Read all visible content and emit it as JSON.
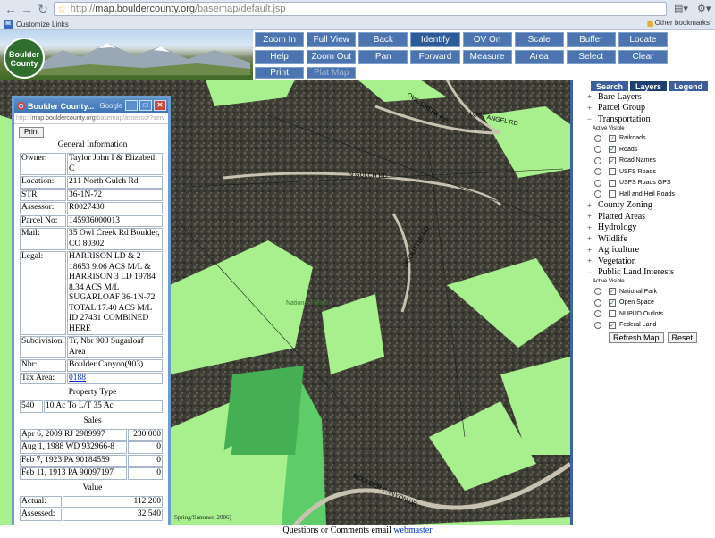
{
  "browser": {
    "url_host": "map.bouldercounty.org",
    "url_path": "/basemap/default.jsp",
    "bookmark_customize": "Customize Links",
    "other_bookmarks": "Other bookmarks"
  },
  "logo": {
    "line1": "Boulder",
    "line2": "County"
  },
  "toolbar": {
    "row1": [
      "Zoom In",
      "Full View",
      "Back",
      "Identify",
      "OV On",
      "Scale",
      "Buffer",
      "Locate",
      "Help"
    ],
    "row2": [
      "Zoom Out",
      "Pan",
      "Forward",
      "Measure",
      "Area",
      "Select",
      "Clear",
      "Print",
      "Plat Map"
    ]
  },
  "map": {
    "road_labels": [
      "OWL CREEK RD",
      "LOST ANGEL RD",
      "N GULCH RD",
      "DOOLITTLE RD",
      "BOULDER CANYON DR"
    ],
    "area_label": "National Forest",
    "imagery_label": "Spring/Summer, 2006)"
  },
  "sidebar": {
    "tabs": [
      "Search",
      "Layers",
      "Legend"
    ],
    "layers_top": [
      "Bare Layers",
      "Parcel Group",
      "Transportation"
    ],
    "active_visible": "Active Visible",
    "transportation_items": [
      {
        "label": "Railroads",
        "checked": true
      },
      {
        "label": "Roads",
        "checked": true
      },
      {
        "label": "Road Names",
        "checked": true
      },
      {
        "label": "USFS Roads",
        "checked": false
      },
      {
        "label": "USFS Roads GPS",
        "checked": false
      },
      {
        "label": "Hall and Heil Roads",
        "checked": false
      }
    ],
    "layers_mid": [
      "County Zoning",
      "Platted Areas",
      "Hydrology",
      "Wildlife",
      "Agriculture",
      "Vegetation",
      "Public Land Interests"
    ],
    "public_land_items": [
      {
        "label": "National Park",
        "checked": true
      },
      {
        "label": "Open Space",
        "checked": true
      },
      {
        "label": "NUPUD Outlots",
        "checked": false
      },
      {
        "label": "Federal Land",
        "checked": true
      }
    ],
    "refresh": "Refresh Map",
    "reset": "Reset"
  },
  "popup": {
    "title": "Boulder County...",
    "title_app": "Google",
    "url_host": "map.bouldercounty.org",
    "url_path": "/basemap/assessor?serv",
    "print": "Print",
    "general_title": "General Information",
    "general": [
      {
        "k": "Owner:",
        "v": "Taylor John I & Elizabeth C"
      },
      {
        "k": "Location:",
        "v": "211 North Gulch Rd"
      },
      {
        "k": "STR:",
        "v": "36-1N-72"
      },
      {
        "k": "Assessor:",
        "v": "R0027430"
      },
      {
        "k": "Parcel No:",
        "v": "145936000013"
      },
      {
        "k": "Mail:",
        "v": "35 Owl Creek Rd Boulder, CO 80302"
      },
      {
        "k": "Legal:",
        "v": "HARRISON LD & 2 18653 9.06 ACS M/L & HARRISON 3 LD 19784 8.34 ACS M/L SUGARLOAF 36-1N-72 TOTAL 17.40 ACS M/L ID 27431 COMBINED HERE"
      },
      {
        "k": "Subdivision:",
        "v": "Tr, Nbr 903 Sugarloaf Area"
      },
      {
        "k": "Nbr:",
        "v": "Boulder Canyon(903)"
      },
      {
        "k": "Tax Area:",
        "v": "0188"
      }
    ],
    "property_type_title": "Property Type",
    "property_type": {
      "code": "540",
      "desc": "10 Ac To L/T 35 Ac"
    },
    "sales_title": "Sales",
    "sales": [
      {
        "desc": "Apr 6, 2009 RJ 2989997",
        "amt": "230,000"
      },
      {
        "desc": "Aug 1, 1988 WD 932966-8",
        "amt": "0"
      },
      {
        "desc": "Feb 7, 1923 PA 90184559",
        "amt": "0"
      },
      {
        "desc": "Feb 11, 1913 PA 90097197",
        "amt": "0"
      }
    ],
    "value_title": "Value",
    "value": [
      {
        "k": "Actual:",
        "v": "112,200"
      },
      {
        "k": "Assessed:",
        "v": "32,540"
      }
    ]
  },
  "footer": {
    "text": "Questions or Comments email",
    "link": "webmaster"
  }
}
